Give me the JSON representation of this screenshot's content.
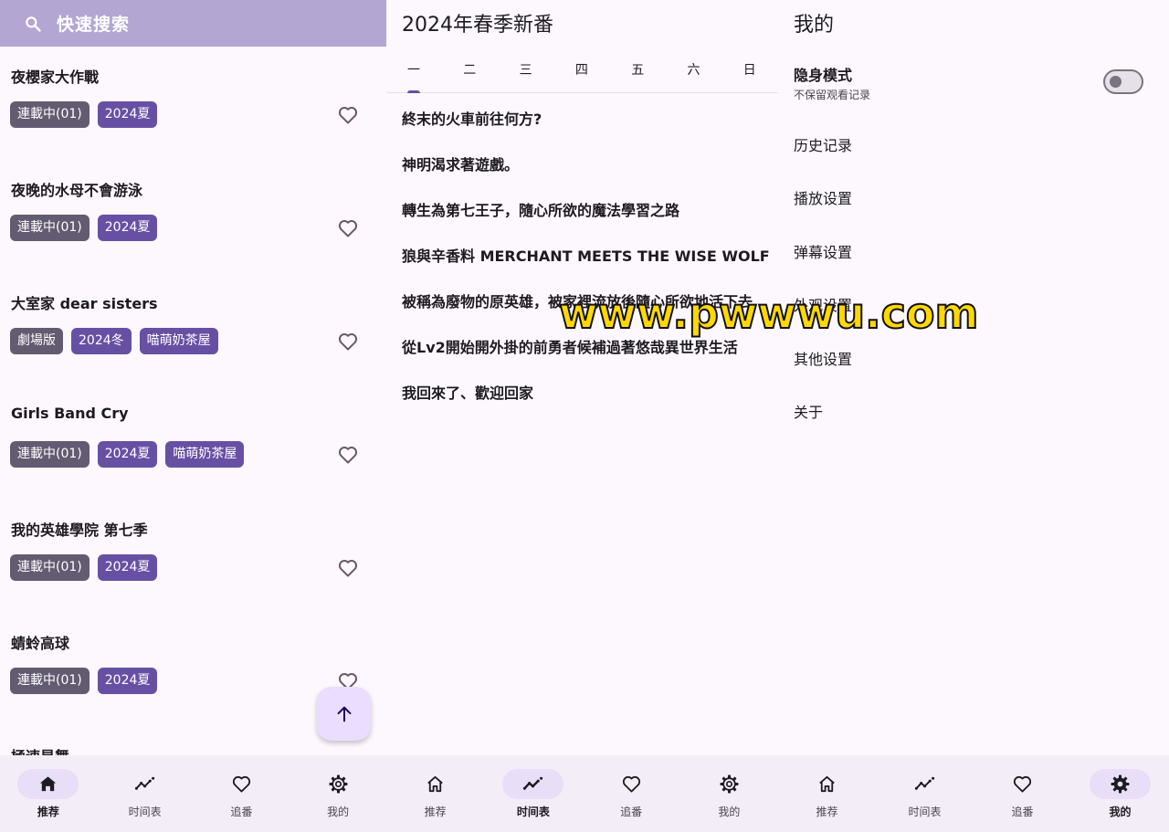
{
  "search": {
    "placeholder": "快速搜索"
  },
  "anime_list": [
    {
      "title": "夜櫻家大作戰",
      "tags": [
        {
          "text": "連載中(01)",
          "style": "grey"
        },
        {
          "text": "2024夏",
          "style": "purple"
        }
      ]
    },
    {
      "title": "夜晚的水母不會游泳",
      "tags": [
        {
          "text": "連載中(01)",
          "style": "grey"
        },
        {
          "text": "2024夏",
          "style": "purple"
        }
      ]
    },
    {
      "title": "大室家 dear sisters",
      "tags": [
        {
          "text": "劇場版",
          "style": "grey"
        },
        {
          "text": "2024冬",
          "style": "purple"
        },
        {
          "text": "喵萌奶茶屋",
          "style": "purple"
        }
      ]
    },
    {
      "title": "Girls Band Cry",
      "tags": [
        {
          "text": "連載中(01)",
          "style": "grey"
        },
        {
          "text": "2024夏",
          "style": "purple"
        },
        {
          "text": "喵萌奶茶屋",
          "style": "purple"
        }
      ]
    },
    {
      "title": "我的英雄學院 第七季",
      "tags": [
        {
          "text": "連載中(01)",
          "style": "grey"
        },
        {
          "text": "2024夏",
          "style": "purple"
        }
      ]
    },
    {
      "title": "蜻蛉高球",
      "tags": [
        {
          "text": "連載中(01)",
          "style": "grey"
        },
        {
          "text": "2024夏",
          "style": "purple"
        }
      ]
    },
    {
      "title": "極速星舞",
      "tags": []
    }
  ],
  "schedule": {
    "title": "2024年春季新番",
    "weekdays": [
      "一",
      "二",
      "三",
      "四",
      "五",
      "六",
      "日"
    ],
    "selected_weekday": "一",
    "shows": [
      "終末的火車前往何方?",
      "神明渴求著遊戲。",
      "轉生為第七王子，隨心所欲的魔法學習之路",
      "狼與辛香料 MERCHANT MEETS THE WISE WOLF",
      "被稱為廢物的原英雄，被家裡流放後隨心所欲地活下去",
      "從Lv2開始開外掛的前勇者候補過著悠哉異世界生活",
      "我回來了、歡迎回家"
    ]
  },
  "mine": {
    "title": "我的",
    "incognito": {
      "label": "隐身模式",
      "sublabel": "不保留观看记录",
      "enabled": false
    },
    "settings": [
      "历史记录",
      "播放设置",
      "弹幕设置",
      "外观设置",
      "其他设置",
      "关于"
    ]
  },
  "nav": {
    "items": [
      {
        "label": "推荐",
        "icon": "home-icon"
      },
      {
        "label": "时间表",
        "icon": "timeline-icon"
      },
      {
        "label": "追番",
        "icon": "heart-icon"
      },
      {
        "label": "我的",
        "icon": "gear-icon"
      }
    ],
    "panels_active": [
      0,
      1,
      3
    ]
  },
  "colors": {
    "primary": "#6750a4",
    "secondary": "#625b71",
    "search_bar": "#b3a6d3",
    "nav_bg": "#f3edf7",
    "active_pill": "#e8def8",
    "background": "#fdf8fd"
  },
  "watermark": {
    "text": "www.pwwwu.com"
  }
}
